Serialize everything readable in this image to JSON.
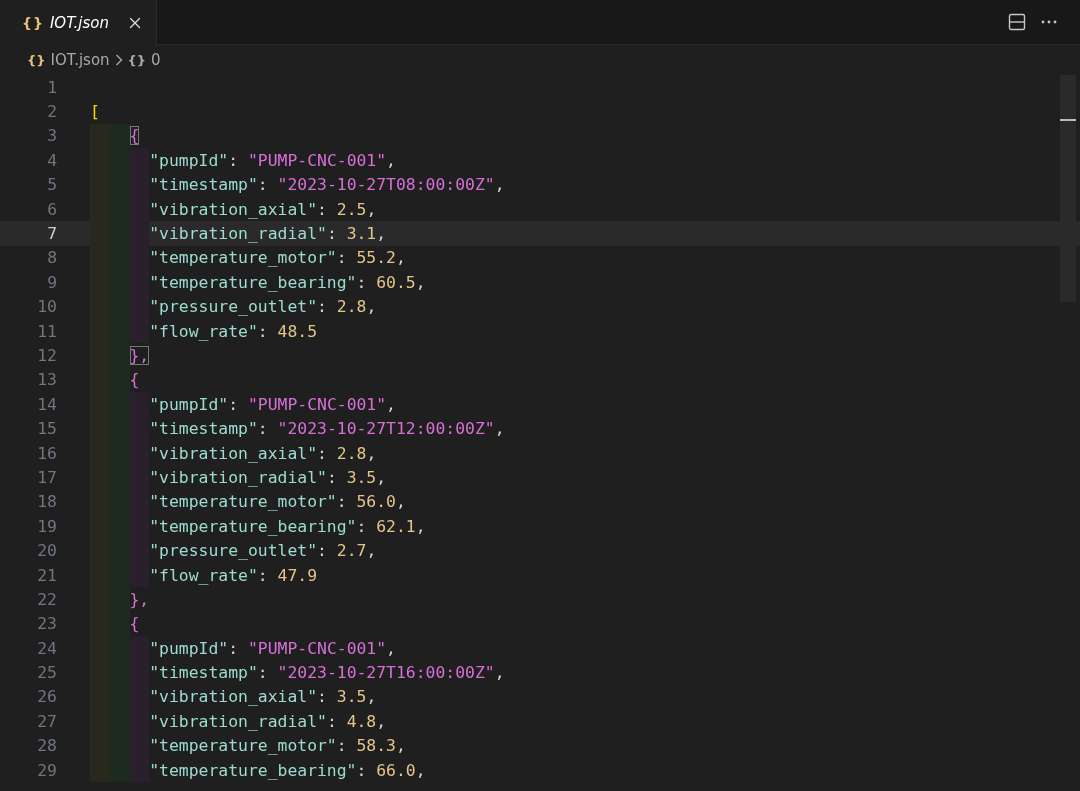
{
  "tab": {
    "icon_text": "{}",
    "title": "IOT.json",
    "preview": true,
    "selected": true
  },
  "breadcrumb": {
    "icon_text": "{}",
    "file": "IOT.json",
    "node_icon_text": "{}",
    "node": "0"
  },
  "editor": {
    "line_numbers": [
      {
        "number": "1",
        "selected": false
      },
      {
        "number": "2",
        "selected": false
      },
      {
        "number": "3",
        "selected": false
      },
      {
        "number": "4",
        "selected": false
      },
      {
        "number": "5",
        "selected": false
      },
      {
        "number": "6",
        "selected": false
      },
      {
        "number": "7",
        "selected": true
      },
      {
        "number": "8",
        "selected": false
      },
      {
        "number": "9",
        "selected": false
      },
      {
        "number": "10",
        "selected": false
      },
      {
        "number": "11",
        "selected": false
      },
      {
        "number": "12",
        "selected": false
      },
      {
        "number": "13",
        "selected": false
      },
      {
        "number": "14",
        "selected": false
      },
      {
        "number": "15",
        "selected": false
      },
      {
        "number": "16",
        "selected": false
      },
      {
        "number": "17",
        "selected": false
      },
      {
        "number": "18",
        "selected": false
      },
      {
        "number": "19",
        "selected": false
      },
      {
        "number": "20",
        "selected": false
      },
      {
        "number": "21",
        "selected": false
      },
      {
        "number": "22",
        "selected": false
      },
      {
        "number": "23",
        "selected": false
      },
      {
        "number": "24",
        "selected": false
      },
      {
        "number": "25",
        "selected": false
      },
      {
        "number": "26",
        "selected": false
      },
      {
        "number": "27",
        "selected": false
      },
      {
        "number": "28",
        "selected": false
      },
      {
        "number": "29",
        "selected": false
      }
    ],
    "root_open": "[",
    "records": [
      {
        "open": "{",
        "close": "},",
        "matched": true,
        "fields": [
          {
            "key": "\"pumpId\"",
            "sep": ":",
            "value": "\"PUMP-CNC-001\"",
            "kind": "string",
            "comma": ","
          },
          {
            "key": "\"timestamp\"",
            "sep": ":",
            "value": "\"2023-10-27T08:00:00Z\"",
            "kind": "string",
            "comma": ","
          },
          {
            "key": "\"vibration_axial\"",
            "sep": ":",
            "value": "2.5",
            "kind": "number",
            "comma": ","
          },
          {
            "key": "\"vibration_radial\"",
            "sep": ":",
            "value": "3.1",
            "kind": "number",
            "comma": ","
          },
          {
            "key": "\"temperature_motor\"",
            "sep": ":",
            "value": "55.2",
            "kind": "number",
            "comma": ","
          },
          {
            "key": "\"temperature_bearing\"",
            "sep": ":",
            "value": "60.5",
            "kind": "number",
            "comma": ","
          },
          {
            "key": "\"pressure_outlet\"",
            "sep": ":",
            "value": "2.8",
            "kind": "number",
            "comma": ","
          },
          {
            "key": "\"flow_rate\"",
            "sep": ":",
            "value": "48.5",
            "kind": "number"
          }
        ]
      },
      {
        "open": "{",
        "close": "},",
        "matched": false,
        "fields": [
          {
            "key": "\"pumpId\"",
            "sep": ":",
            "value": "\"PUMP-CNC-001\"",
            "kind": "string",
            "comma": ","
          },
          {
            "key": "\"timestamp\"",
            "sep": ":",
            "value": "\"2023-10-27T12:00:00Z\"",
            "kind": "string",
            "comma": ","
          },
          {
            "key": "\"vibration_axial\"",
            "sep": ":",
            "value": "2.8",
            "kind": "number",
            "comma": ","
          },
          {
            "key": "\"vibration_radial\"",
            "sep": ":",
            "value": "3.5",
            "kind": "number",
            "comma": ","
          },
          {
            "key": "\"temperature_motor\"",
            "sep": ":",
            "value": "56.0",
            "kind": "number",
            "comma": ","
          },
          {
            "key": "\"temperature_bearing\"",
            "sep": ":",
            "value": "62.1",
            "kind": "number",
            "comma": ","
          },
          {
            "key": "\"pressure_outlet\"",
            "sep": ":",
            "value": "2.7",
            "kind": "number",
            "comma": ","
          },
          {
            "key": "\"flow_rate\"",
            "sep": ":",
            "value": "47.9",
            "kind": "number"
          }
        ]
      },
      {
        "open": "{",
        "matched": false,
        "fields": [
          {
            "key": "\"pumpId\"",
            "sep": ":",
            "value": "\"PUMP-CNC-001\"",
            "kind": "string",
            "comma": ","
          },
          {
            "key": "\"timestamp\"",
            "sep": ":",
            "value": "\"2023-10-27T16:00:00Z\"",
            "kind": "string",
            "comma": ","
          },
          {
            "key": "\"vibration_axial\"",
            "sep": ":",
            "value": "3.5",
            "kind": "number",
            "comma": ","
          },
          {
            "key": "\"vibration_radial\"",
            "sep": ":",
            "value": "4.8",
            "kind": "number",
            "comma": ","
          },
          {
            "key": "\"temperature_motor\"",
            "sep": ":",
            "value": "58.3",
            "kind": "number",
            "comma": ","
          },
          {
            "key": "\"temperature_bearing\"",
            "sep": ":",
            "value": "66.0",
            "kind": "number",
            "comma": ","
          }
        ]
      }
    ]
  }
}
